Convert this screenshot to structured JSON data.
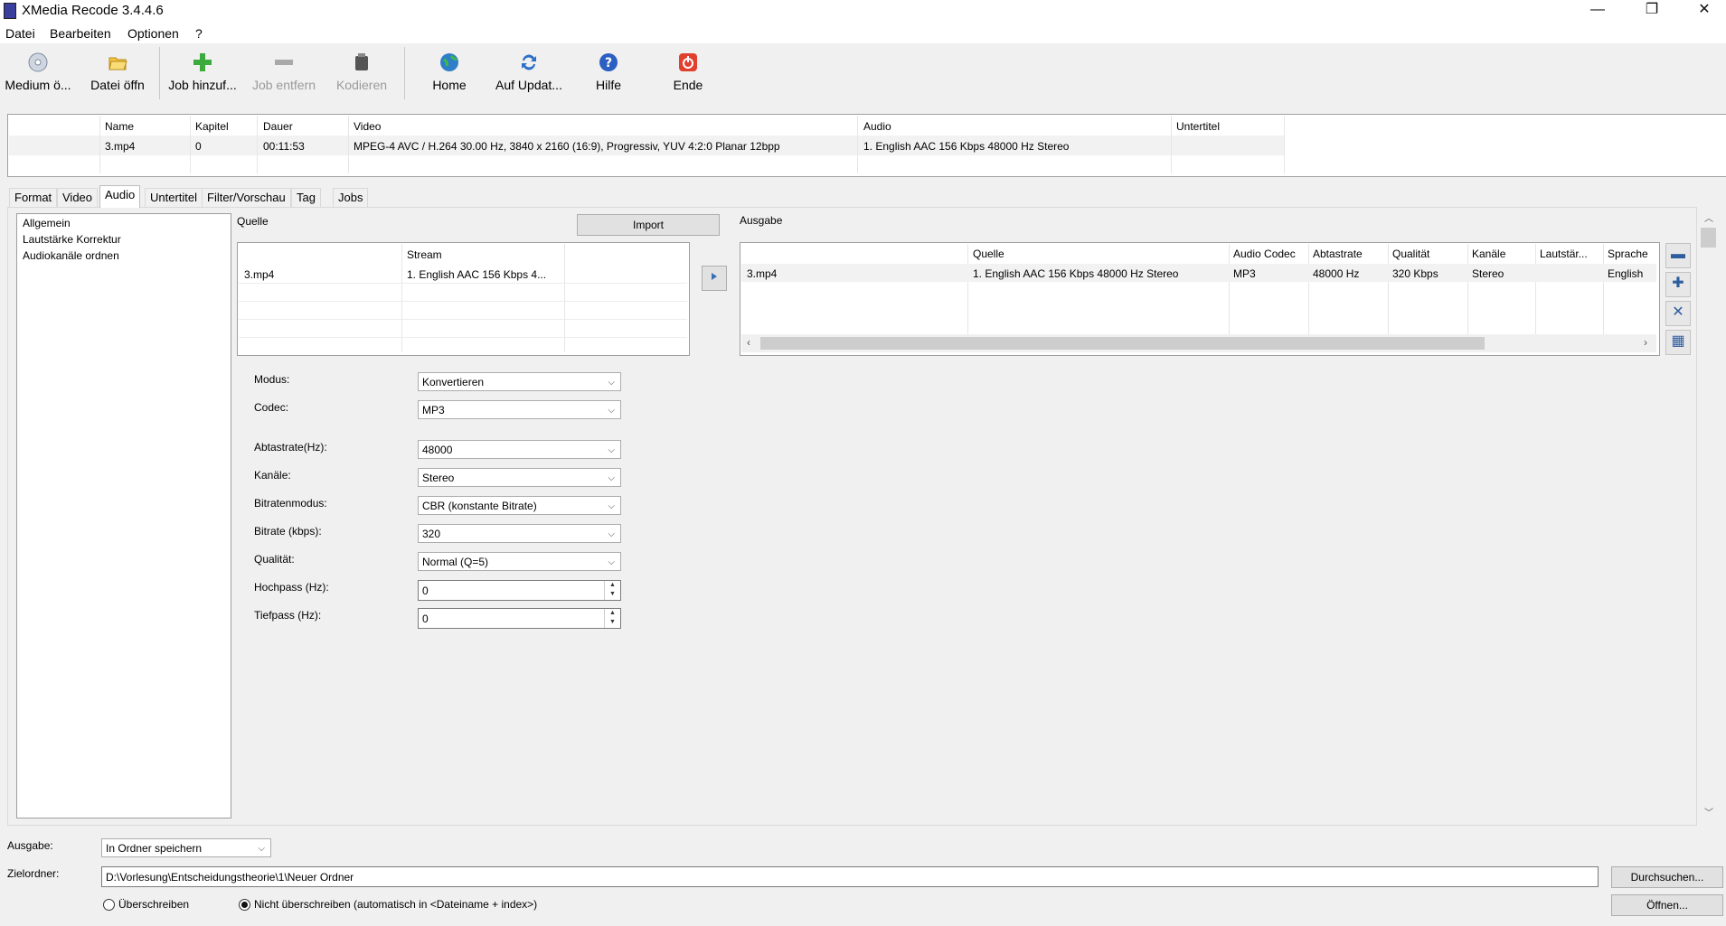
{
  "window": {
    "title": "XMedia Recode 3.4.4.6",
    "minimize": "—",
    "restore": "❐",
    "close": "✕"
  },
  "menu": [
    "Datei",
    "Bearbeiten",
    "Optionen",
    "?"
  ],
  "toolbar": [
    {
      "label": "Medium ö...",
      "icon": "disc-icon",
      "enabled": true
    },
    {
      "label": "Datei öffn",
      "icon": "folder-open-icon",
      "enabled": true
    },
    {
      "label": "Job hinzuf...",
      "icon": "plus-icon",
      "enabled": true
    },
    {
      "label": "Job entfern",
      "icon": "minus-icon",
      "enabled": false
    },
    {
      "label": "Kodieren",
      "icon": "encode-icon",
      "enabled": false
    },
    {
      "label": "Home",
      "icon": "globe-icon",
      "enabled": true
    },
    {
      "label": "Auf Updat...",
      "icon": "refresh-icon",
      "enabled": true
    },
    {
      "label": "Hilfe",
      "icon": "help-icon",
      "enabled": true
    },
    {
      "label": "Ende",
      "icon": "power-icon",
      "enabled": true
    }
  ],
  "jobs": {
    "headers": [
      "Name",
      "Kapitel",
      "Dauer",
      "Video",
      "Audio",
      "Untertitel"
    ],
    "rows": [
      [
        "3.mp4",
        "0",
        "00:11:53",
        "MPEG-4 AVC / H.264 30.00 Hz, 3840 x 2160 (16:9), Progressiv, YUV 4:2:0 Planar 12bpp",
        "1. English AAC  156 Kbps 48000 Hz Stereo",
        ""
      ]
    ]
  },
  "tabs": [
    "Format",
    "Video",
    "Audio",
    "Untertitel",
    "Filter/Vorschau",
    "Tag",
    "Jobs"
  ],
  "active_tab": "Audio",
  "nav": [
    "Allgemein",
    "Lautstärke Korrektur",
    "Audiokanäle ordnen"
  ],
  "source": {
    "title": "Quelle",
    "import_label": "Import",
    "headers": [
      "",
      "Stream"
    ],
    "rows": [
      [
        "3.mp4",
        "1. English AAC  156 Kbps 4..."
      ]
    ]
  },
  "output": {
    "title": "Ausgabe",
    "headers": [
      "",
      "Quelle",
      "Audio Codec",
      "Abtastrate",
      "Qualität",
      "Kanäle",
      "Lautstär...",
      "Sprache"
    ],
    "rows": [
      [
        "3.mp4",
        "1. English AAC  156 Kbps 48000 Hz Stereo",
        "MP3",
        "48000 Hz",
        "320 Kbps",
        "Stereo",
        "",
        "English"
      ]
    ]
  },
  "settings": [
    {
      "label": "Modus:",
      "value": "Konvertieren",
      "type": "combo"
    },
    {
      "label": "Codec:",
      "value": "MP3",
      "type": "combo"
    },
    {
      "label": "Abtastrate(Hz):",
      "value": "48000",
      "type": "combo"
    },
    {
      "label": "Kanäle:",
      "value": "Stereo",
      "type": "combo"
    },
    {
      "label": "Bitratenmodus:",
      "value": "CBR (konstante Bitrate)",
      "type": "combo"
    },
    {
      "label": "Bitrate (kbps):",
      "value": "320",
      "type": "combo"
    },
    {
      "label": "Qualität:",
      "value": "Normal (Q=5)",
      "type": "combo"
    },
    {
      "label": "Hochpass (Hz):",
      "value": "0",
      "type": "spin"
    },
    {
      "label": "Tiefpass (Hz):",
      "value": "0",
      "type": "spin"
    }
  ],
  "bottom": {
    "ausgabe_label": "Ausgabe:",
    "ausgabe_value": "In Ordner speichern",
    "zielordner_label": "Zielordner:",
    "zielordner_value": "D:\\Vorlesung\\Entscheidungstheorie\\1\\Neuer Ordner",
    "browse_label": "Durchsuchen...",
    "open_label": "Öffnen...",
    "overwrite_label": "Überschreiben",
    "no_overwrite_label": "Nicht überschreiben (automatisch in <Dateiname + index>)",
    "overwrite_selected": false
  },
  "colors": {
    "accent": "#2e5d9e",
    "disabled_text": "#9a9a9a"
  }
}
